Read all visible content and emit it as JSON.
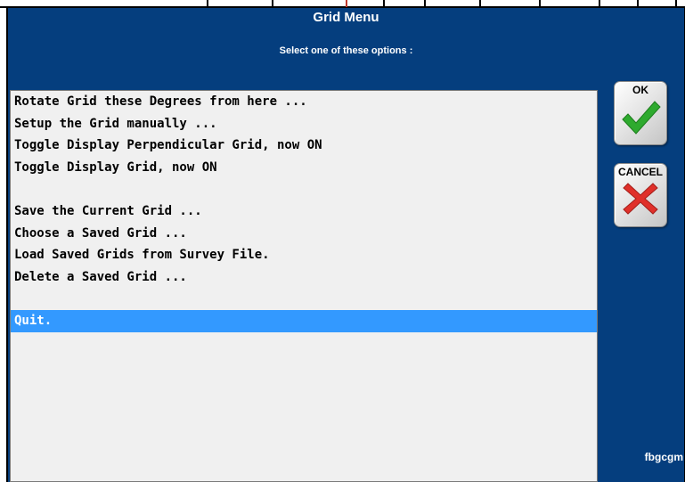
{
  "dialog": {
    "title": "Grid Menu",
    "subtitle": "Select one of these options :",
    "footer_code": "fbgcgm"
  },
  "menu": {
    "items": [
      {
        "label": "Rotate Grid these Degrees from here ..."
      },
      {
        "label": "Setup the Grid manually ..."
      },
      {
        "label": "Toggle Display Perpendicular Grid, now ON"
      },
      {
        "label": "Toggle Display Grid, now ON"
      },
      {
        "label": ""
      },
      {
        "label": "Save the Current Grid ..."
      },
      {
        "label": "Choose a Saved Grid ..."
      },
      {
        "label": "Load Saved Grids from Survey File."
      },
      {
        "label": "Delete a Saved Grid ..."
      },
      {
        "label": ""
      },
      {
        "label": "Quit."
      }
    ],
    "selected_label": "Quit."
  },
  "buttons": {
    "ok_label": "OK",
    "ok_icon": "checkmark-icon",
    "cancel_label": "CANCEL",
    "cancel_icon": "x-icon"
  },
  "colors": {
    "background": "#053e7e",
    "list_background": "#f0f0f0",
    "selection": "#3399ff",
    "ok_icon": "#2eaa2e",
    "cancel_icon": "#e0302a"
  }
}
